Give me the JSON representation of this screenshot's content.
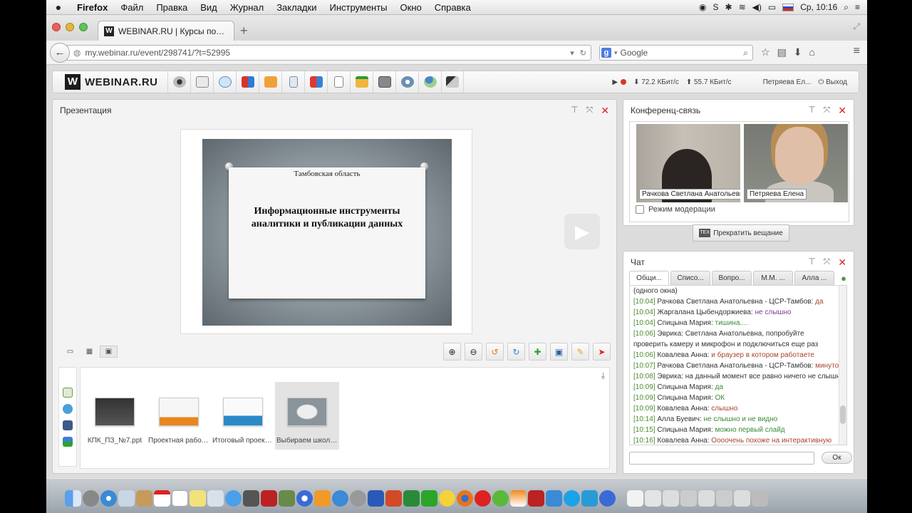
{
  "menubar": {
    "apple": "",
    "items": [
      "Firefox",
      "Файл",
      "Правка",
      "Вид",
      "Журнал",
      "Закладки",
      "Инструменты",
      "Окно",
      "Справка"
    ],
    "clock": "Ср, 10:16"
  },
  "browser": {
    "tab_title": "WEBINAR.RU | Курсы повы...",
    "favicon": "W",
    "new_tab": "+",
    "url": "my.webinar.ru/event/298741/?t=52995",
    "search_engine": "g",
    "search_placeholder": "Google"
  },
  "app": {
    "logo": "W",
    "brand": "WEBINAR.RU",
    "tools": [
      "webcam-icon",
      "presentation-icon",
      "chat-icon",
      "cubes-icon",
      "folder-icon",
      "document-icon",
      "box-icon",
      "notes-icon",
      "share-icon",
      "layout-icon",
      "settings-icon",
      "add-user-icon",
      "mic-lock-icon"
    ],
    "download_speed": "72.2 КБит/с",
    "upload_speed": "55.7 КБит/с",
    "user": "Петряева Ел...",
    "logout": "Выход"
  },
  "presentation": {
    "title": "Презентация",
    "slide_region": "Тамбовская область",
    "slide_title": "Информационные инструменты аналитики и публикации данных",
    "files": [
      {
        "name": "КПК_ПЗ_№7.ppt"
      },
      {
        "name": "Проектная работа..."
      },
      {
        "name": "Итоговый проект ..."
      },
      {
        "name": "Выбираем школу ..."
      }
    ]
  },
  "conference": {
    "title": "Конференц-связь",
    "cams": [
      {
        "name": "Рачкова Светлана Анатольевн"
      },
      {
        "name": "Петряева Елена"
      }
    ],
    "moderation": "Режим модерации",
    "stop_button": "Прекратить вещание",
    "stop_badge": "TEX"
  },
  "chat": {
    "title": "Чат",
    "tabs": [
      "Общи...",
      "Списо...",
      "Вопро...",
      "М.М. ...",
      "Алла ..."
    ],
    "pre": "(одного окна)",
    "messages": [
      {
        "time": "[10:04]",
        "author": "Рачкова Светлана Анатольевна - ЦСР-Тамбов:",
        "text": "да",
        "cls": "m1"
      },
      {
        "time": "[10:04]",
        "author": "Жаргалана Цыбендоржиева:",
        "text": "не слышно",
        "cls": "m3"
      },
      {
        "time": "[10:04]",
        "author": "Спицына Мария:",
        "text": "тишина....",
        "cls": "m2"
      },
      {
        "time": "[10:06]",
        "author": "Эврика:",
        "text": "Светлана Анатольевна, попробуйте проверить камеру и микрофон и подключиться еще раз",
        "cls": "plain"
      },
      {
        "time": "[10:06]",
        "author": "Ковалева Анна:",
        "text": "и браузер в котором работаете",
        "cls": "m1"
      },
      {
        "time": "[10:07]",
        "author": "Рачкова Светлана Анатольевна - ЦСР-Тамбов:",
        "text": "минуточку",
        "cls": "m1"
      },
      {
        "time": "[10:08]",
        "author": "Эврика:",
        "text": "на данный момент все равно ничего не слышно",
        "cls": "plain"
      },
      {
        "time": "[10:09]",
        "author": "Спицына Мария:",
        "text": "да",
        "cls": "m2"
      },
      {
        "time": "[10:09]",
        "author": "Спицына Мария:",
        "text": "ОК",
        "cls": "m2"
      },
      {
        "time": "[10:09]",
        "author": "Ковалева Анна:",
        "text": "слышно",
        "cls": "m1"
      },
      {
        "time": "[10:14]",
        "author": "Алла Буевич:",
        "text": "не слышно и не видно",
        "cls": "m2"
      },
      {
        "time": "[10:15]",
        "author": "Спицына Мария:",
        "text": "можно первый слайд",
        "cls": "m2"
      },
      {
        "time": "[10:16]",
        "author": "Ковалева Анна:",
        "text": "Оооочень похоже на интерактивную",
        "cls": "m1"
      }
    ],
    "send_button": "Ок"
  }
}
